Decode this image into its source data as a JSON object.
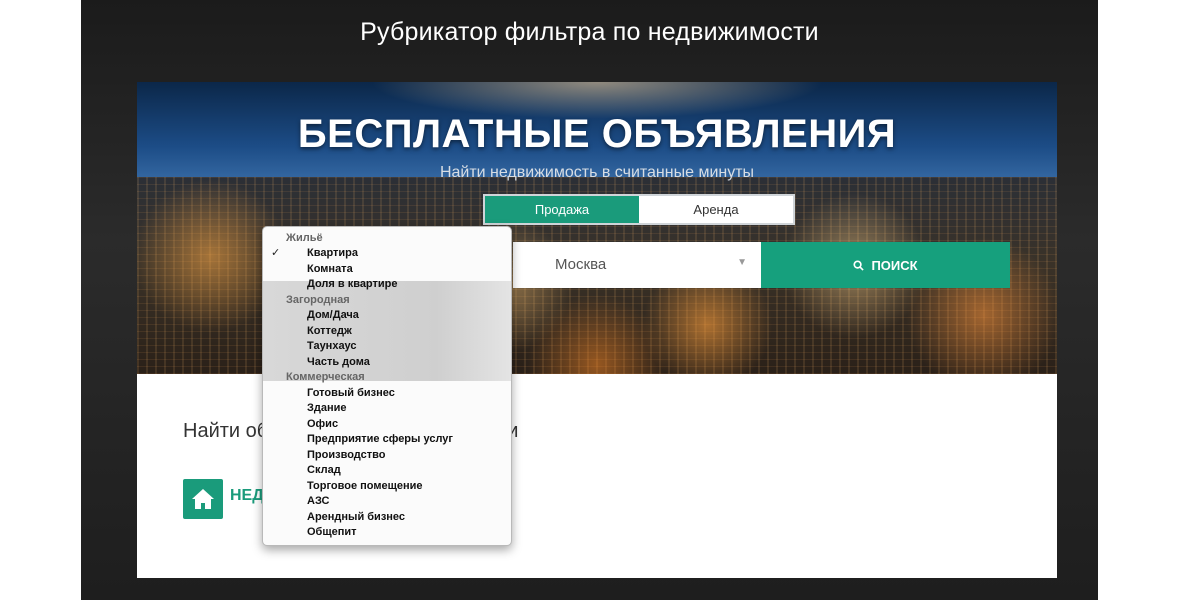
{
  "slide": {
    "title": "Рубрикатор фильтра по недвижимости"
  },
  "hero": {
    "title": "БЕСПЛАТНЫЕ ОБЪЯВЛЕНИЯ",
    "subtitle": "Найти недвижимость в считанные минуты"
  },
  "tabs": [
    {
      "label": "Продажа",
      "active": true
    },
    {
      "label": "Аренда",
      "active": false
    }
  ],
  "city_select": {
    "value": "Москва"
  },
  "search_button": {
    "label": "ПОИСК"
  },
  "below": {
    "title_visible": "Найти об",
    "title_visible_tail": "и",
    "category_label_visible": "НЕД"
  },
  "dropdown": {
    "selected": "Квартира",
    "groups": [
      {
        "label": "Жильё",
        "items": [
          "Квартира",
          "Комната",
          "Доля в квартире"
        ]
      },
      {
        "label": "Загородная",
        "items": [
          "Дом/Дача",
          "Коттедж",
          "Таунхаус",
          "Часть дома"
        ]
      },
      {
        "label": "Коммерческая",
        "items": [
          "Готовый бизнес",
          "Здание",
          "Офис",
          "Предприятие сферы услуг",
          "Производство",
          "Склад",
          "Торговое помещение",
          "АЗС",
          "Арендный бизнес",
          "Общепит"
        ]
      }
    ]
  },
  "colors": {
    "accent": "#1a9b7b",
    "frame": "#1e1e1e"
  }
}
